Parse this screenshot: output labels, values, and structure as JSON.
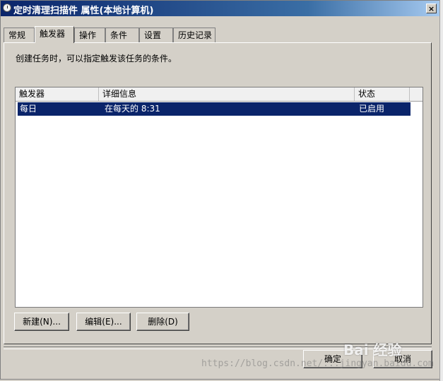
{
  "window": {
    "title": "定时清理扫描件 属性(本地计算机)",
    "close_label": "×"
  },
  "tabs": [
    {
      "label": "常规"
    },
    {
      "label": "触发器"
    },
    {
      "label": "操作"
    },
    {
      "label": "条件"
    },
    {
      "label": "设置"
    },
    {
      "label": "历史记录"
    }
  ],
  "active_tab": "触发器",
  "description": "创建任务时，可以指定触发该任务的条件。",
  "table": {
    "columns": [
      "触发器",
      "详细信息",
      "状态"
    ],
    "rows": [
      {
        "trigger": "每日",
        "details": "在每天的 8:31",
        "status": "已启用",
        "selected": true
      }
    ]
  },
  "buttons": {
    "new": "新建(N)...",
    "edit": "编辑(E)...",
    "delete": "删除(D)",
    "ok": "确定",
    "cancel": "取消"
  },
  "watermark": {
    "url": "https://blog.csdn.net/...jingyan.baidu.com",
    "logo": "Bai 经验"
  },
  "colors": {
    "selection": "#0a246a",
    "titlebar": "#0a246a",
    "face": "#d4d0c8"
  }
}
